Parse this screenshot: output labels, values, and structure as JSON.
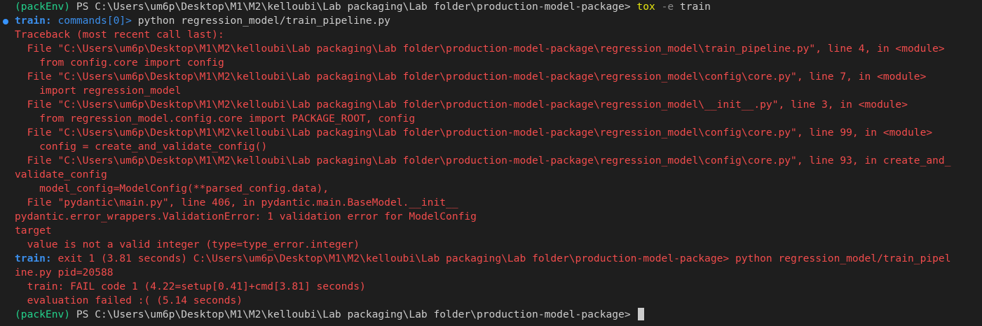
{
  "prompt": {
    "env": "(packEnv)",
    "text": " PS C:\\Users\\um6p\\Desktop\\M1\\M2\\kelloubi\\Lab packaging\\Lab folder\\production-model-package> "
  },
  "first_command": {
    "exe": "tox",
    "flag": " -e",
    "arg": " train"
  },
  "tox_command_line": {
    "label": "train:",
    "commands": " commands[0]>",
    "text": " python regression_model/train_pipeline.py"
  },
  "traceback_lines": [
    "Traceback (most recent call last):",
    "  File \"C:\\Users\\um6p\\Desktop\\M1\\M2\\kelloubi\\Lab packaging\\Lab folder\\production-model-package\\regression_model\\train_pipeline.py\", line 4, in <module>",
    "    from config.core import config",
    "  File \"C:\\Users\\um6p\\Desktop\\M1\\M2\\kelloubi\\Lab packaging\\Lab folder\\production-model-package\\regression_model\\config\\core.py\", line 7, in <module>",
    "    import regression_model",
    "  File \"C:\\Users\\um6p\\Desktop\\M1\\M2\\kelloubi\\Lab packaging\\Lab folder\\production-model-package\\regression_model\\__init__.py\", line 3, in <module>",
    "    from regression_model.config.core import PACKAGE_ROOT, config",
    "  File \"C:\\Users\\um6p\\Desktop\\M1\\M2\\kelloubi\\Lab packaging\\Lab folder\\production-model-package\\regression_model\\config\\core.py\", line 99, in <module>",
    "    config = create_and_validate_config()",
    "  File \"C:\\Users\\um6p\\Desktop\\M1\\M2\\kelloubi\\Lab packaging\\Lab folder\\production-model-package\\regression_model\\config\\core.py\", line 93, in create_and_",
    "validate_config",
    "    model_config=ModelConfig(**parsed_config.data),",
    "  File \"pydantic\\main.py\", line 406, in pydantic.main.BaseModel.__init__",
    "pydantic.error_wrappers.ValidationError: 1 validation error for ModelConfig",
    "target",
    "  value is not a valid integer (type=type_error.integer)"
  ],
  "exit_line": {
    "label": "train:",
    "text": " exit 1 (3.81 seconds) C:\\Users\\um6p\\Desktop\\M1\\M2\\kelloubi\\Lab packaging\\Lab folder\\production-model-package> python regression_model/train_pipel",
    "wrap": "ine.py pid=20588"
  },
  "summary_lines": [
    "  train: FAIL code 1 (4.22=setup[0.41]+cmd[3.81] seconds)",
    "  evaluation failed :( (5.14 seconds)"
  ],
  "colors": {
    "background": "#1e1e1e",
    "foreground": "#cccccc",
    "env_green": "#23d18b",
    "command_yellow": "#e5e510",
    "tox_blue": "#3b8eea",
    "error_red": "#f14c4c",
    "decoration_blue": "#3794ff"
  }
}
